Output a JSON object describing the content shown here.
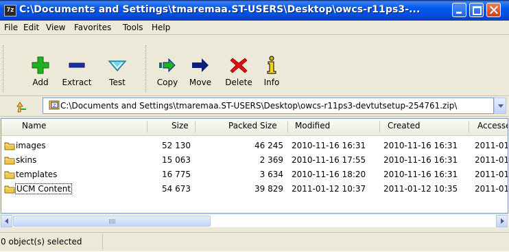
{
  "window": {
    "title": "C:\\Documents and Settings\\tmaremaa.ST-USERS\\Desktop\\owcs-r11ps3-...",
    "app_icon": "7z"
  },
  "menu": [
    "File",
    "Edit",
    "View",
    "Favorites",
    "Tools",
    "Help"
  ],
  "toolbar": [
    {
      "label": "Add",
      "icon": "plus-icon"
    },
    {
      "label": "Extract",
      "icon": "minus-icon"
    },
    {
      "label": "Test",
      "icon": "check-icon"
    },
    {
      "label": "Copy",
      "icon": "copy-arrow-icon"
    },
    {
      "label": "Move",
      "icon": "move-arrow-icon"
    },
    {
      "label": "Delete",
      "icon": "delete-x-icon"
    },
    {
      "label": "Info",
      "icon": "info-icon"
    }
  ],
  "address": {
    "path": "C:\\Documents and Settings\\tmaremaa.ST-USERS\\Desktop\\owcs-r11ps3-devtutsetup-254761.zip\\"
  },
  "columns": [
    "Name",
    "Size",
    "Packed Size",
    "Modified",
    "Created",
    "Accesse"
  ],
  "rows": [
    {
      "name": "images",
      "size": "52 130",
      "packed": "46 245",
      "modified": "2010-11-16 16:31",
      "created": "2010-11-16 16:31",
      "accessed": "2011-01"
    },
    {
      "name": "skins",
      "size": "15 063",
      "packed": "2 369",
      "modified": "2010-11-16 17:55",
      "created": "2010-11-16 16:31",
      "accessed": "2011-01"
    },
    {
      "name": "templates",
      "size": "16 775",
      "packed": "3 634",
      "modified": "2010-11-16 18:20",
      "created": "2010-11-16 16:31",
      "accessed": "2011-01"
    },
    {
      "name": "UCM Content",
      "size": "54 673",
      "packed": "39 829",
      "modified": "2011-01-12 10:37",
      "created": "2011-01-12 10:35",
      "accessed": "2011-01"
    }
  ],
  "status": {
    "text": "0 object(s) selected"
  },
  "colors": {
    "titlebar": "#0058ee",
    "folder": "#f1c64d",
    "add": "#1fb11f",
    "delete": "#e01010",
    "arrows": "#0a1e7a"
  }
}
